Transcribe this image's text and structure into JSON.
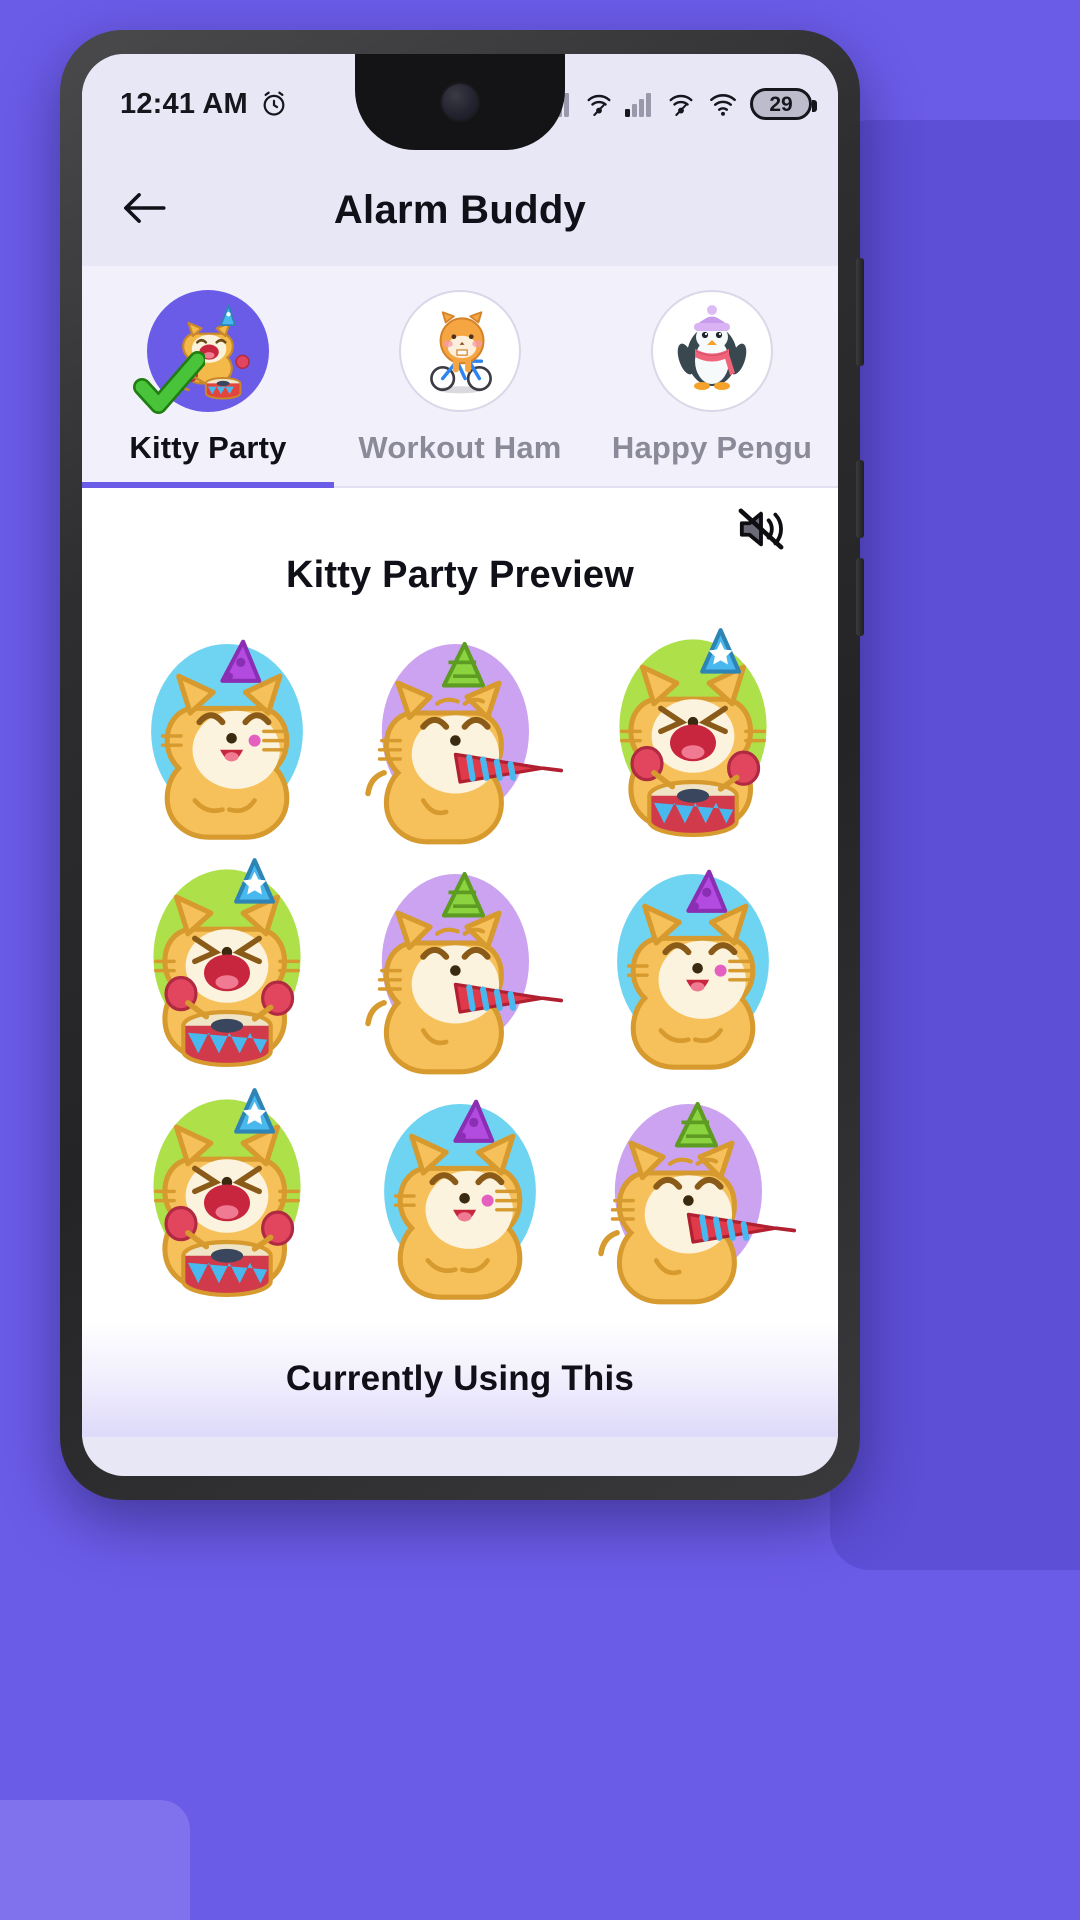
{
  "theme": {
    "backdrop_purple": "#6B5CE8",
    "accent_purple": "#6B5CE8",
    "screen_bg": "#E8E7F6",
    "tabbar_bg": "#F2F1FB",
    "preview_bg": "#FFFFFF",
    "check_green": "#49C43A"
  },
  "status_bar": {
    "time": "12:41 AM",
    "alarm_icon": "alarm-clock-icon",
    "bluetooth_icon": "bluetooth-icon",
    "signal_one_icon": "cellular-signal-icon",
    "nfc_one_icon": "wifi-calling-icon",
    "signal_two_icon": "cellular-signal-icon",
    "nfc_two_icon": "wifi-calling-icon",
    "wifi_icon": "wifi-icon",
    "battery_level": "29"
  },
  "app_bar": {
    "back_icon": "back-arrow-icon",
    "title": "Alarm Buddy"
  },
  "tabs": [
    {
      "label": "Kitty Party",
      "avatar": "kitty-drummer-avatar",
      "selected": true,
      "check_icon": "green-check-icon"
    },
    {
      "label": "Workout Ham",
      "avatar": "hamster-bicycle-avatar",
      "selected": false,
      "check_icon": ""
    },
    {
      "label": "Happy Pengu",
      "avatar": "penguin-scarf-avatar",
      "selected": false,
      "check_icon": ""
    }
  ],
  "preview": {
    "mute_icon": "volume-off-icon",
    "title": "Kitty Party Preview",
    "stickers": [
      {
        "pose": "wave",
        "bg": "#6FD3F2",
        "hat": "#B44BE0",
        "name": "kitty-wave-sticker"
      },
      {
        "pose": "blower",
        "bg": "#CBA3F0",
        "hat": "#8CD43F",
        "name": "kitty-blower-sticker"
      },
      {
        "pose": "drum",
        "bg": "#AEE04A",
        "hat": "#49B8EE",
        "name": "kitty-drum-sticker"
      },
      {
        "pose": "drum",
        "bg": "#AEE04A",
        "hat": "#49B8EE",
        "name": "kitty-drum-sticker"
      },
      {
        "pose": "blower",
        "bg": "#CBA3F0",
        "hat": "#8CD43F",
        "name": "kitty-blower-sticker"
      },
      {
        "pose": "wave",
        "bg": "#6FD3F2",
        "hat": "#B44BE0",
        "name": "kitty-wave-sticker"
      },
      {
        "pose": "drum",
        "bg": "#AEE04A",
        "hat": "#49B8EE",
        "name": "kitty-drum-sticker"
      },
      {
        "pose": "wave",
        "bg": "#6FD3F2",
        "hat": "#B44BE0",
        "name": "kitty-wave-sticker"
      },
      {
        "pose": "blower",
        "bg": "#CBA3F0",
        "hat": "#8CD43F",
        "name": "kitty-blower-sticker"
      }
    ]
  },
  "footer": {
    "label": "Currently Using This"
  }
}
